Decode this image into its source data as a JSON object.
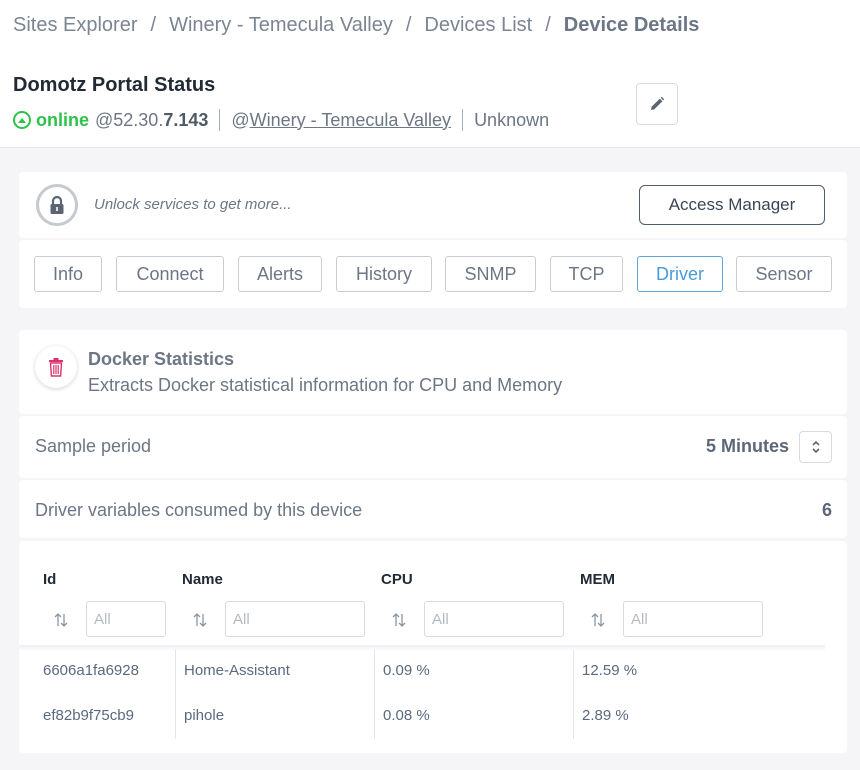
{
  "breadcrumb": {
    "items": [
      "Sites Explorer",
      "Winery - Temecula Valley",
      "Devices List"
    ],
    "separator": "/",
    "current": "Device Details"
  },
  "device": {
    "title": "Domotz Portal Status",
    "status": "online",
    "ip_prefix": "@52.30.",
    "ip_suffix": "7.143",
    "site_prefix": "@",
    "site": "Winery - Temecula Valley",
    "type": "Unknown"
  },
  "unlock": {
    "text": "Unlock services to get more...",
    "button_label": "Access Manager"
  },
  "tabs": [
    {
      "label": "Info"
    },
    {
      "label": "Connect"
    },
    {
      "label": "Alerts"
    },
    {
      "label": "History"
    },
    {
      "label": "SNMP"
    },
    {
      "label": "TCP"
    },
    {
      "label": "Driver",
      "active": true
    },
    {
      "label": "Sensor"
    }
  ],
  "driver": {
    "name": "Docker Statistics",
    "description": "Extracts Docker statistical information for CPU and Memory"
  },
  "sample_period": {
    "label": "Sample period",
    "value": "5 Minutes"
  },
  "variables": {
    "label": "Driver variables consumed by this device",
    "count": "6"
  },
  "table": {
    "columns": [
      "Id",
      "Name",
      "CPU",
      "MEM"
    ],
    "filter_placeholder": "All",
    "rows": [
      [
        "6606a1fa6928",
        "Home-Assistant",
        "0.09 %",
        "12.59 %"
      ],
      [
        "ef82b9f75cb9",
        "pihole",
        "0.08 %",
        "2.89 %"
      ]
    ]
  },
  "colors": {
    "online": "#2ec24a",
    "active_tab": "#4a9ad8",
    "driver_icon": "#d9336b"
  }
}
